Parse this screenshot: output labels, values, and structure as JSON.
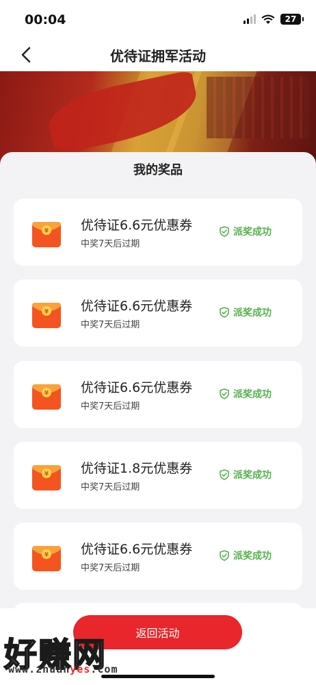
{
  "status_bar": {
    "time": "00:04",
    "battery": "27"
  },
  "nav": {
    "title": "优待证拥军活动",
    "back_icon": "chevron-left-icon"
  },
  "sheet": {
    "title": "我的奖品"
  },
  "prizes": [
    {
      "title": "优待证6.6元优惠券",
      "subtitle": "中奖7天后过期",
      "status": "派奖成功"
    },
    {
      "title": "优待证6.6元优惠券",
      "subtitle": "中奖7天后过期",
      "status": "派奖成功"
    },
    {
      "title": "优待证6.6元优惠券",
      "subtitle": "中奖7天后过期",
      "status": "派奖成功"
    },
    {
      "title": "优待证1.8元优惠券",
      "subtitle": "中奖7天后过期",
      "status": "派奖成功"
    },
    {
      "title": "优待证6.6元优惠券",
      "subtitle": "中奖7天后过期",
      "status": "派奖成功"
    }
  ],
  "footer": {
    "return_label": "返回活动"
  },
  "watermark": {
    "chars": "好赚网",
    "domain_pre": "www.zhuan",
    "domain_hl": "yes",
    "domain_post": ".com"
  },
  "colors": {
    "accent_red": "#e8262b",
    "success_green": "#52b24a"
  }
}
